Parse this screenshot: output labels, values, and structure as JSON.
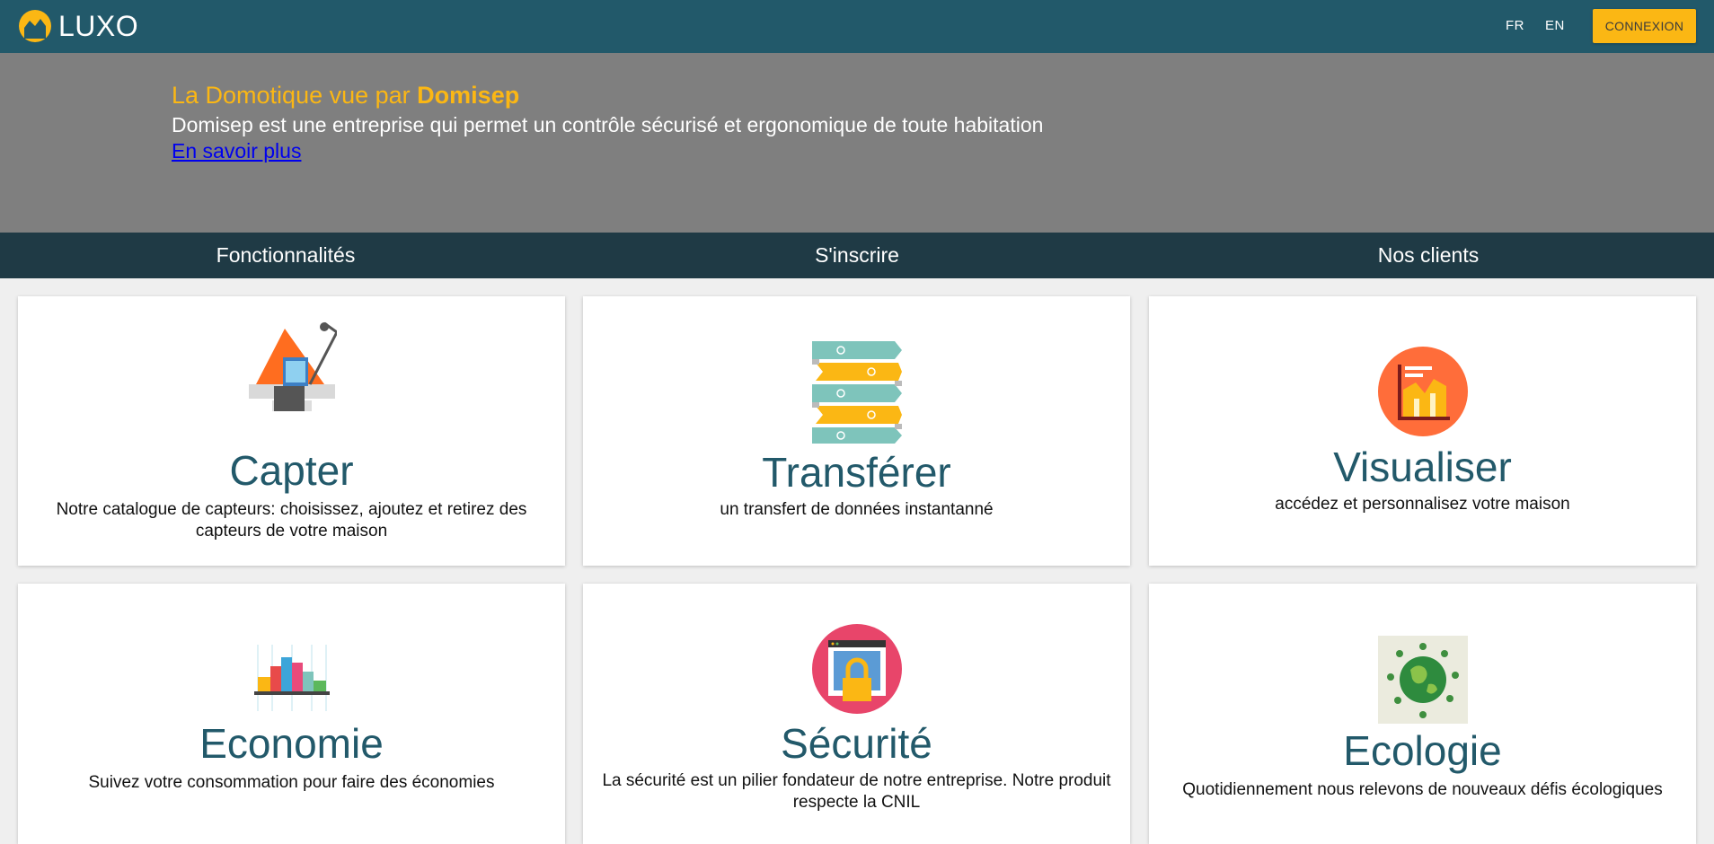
{
  "header": {
    "brand": "LUXO",
    "lang_fr": "FR",
    "lang_en": "EN",
    "login_label": "CONNEXION"
  },
  "hero": {
    "title_prefix": "La Domotique vue par ",
    "title_brand": "Domisep",
    "subtitle": "Domisep est une entreprise qui permet un contrôle sécurisé et ergonomique de toute habitation",
    "link": "En savoir plus"
  },
  "tabs": [
    "Fonctionnalités",
    "S'inscrire",
    "Nos clients"
  ],
  "features": [
    {
      "title": "Capter",
      "desc": "Notre catalogue de capteurs: choisissez, ajoutez et retirez des capteurs de votre maison",
      "icon": "desk-lamp-icon"
    },
    {
      "title": "Transférer",
      "desc": "un transfert de données instantanné",
      "icon": "transfer-arrows-icon"
    },
    {
      "title": "Visualiser",
      "desc": "accédez et personnalisez votre maison",
      "icon": "chart-icon"
    },
    {
      "title": "Economie",
      "desc": "Suivez votre consommation pour faire des économies",
      "icon": "city-icon"
    },
    {
      "title": "Sécurité",
      "desc": "La sécurité est un pilier fondateur de notre entreprise. Notre produit respecte la CNIL",
      "icon": "lock-icon"
    },
    {
      "title": "Ecologie",
      "desc": "Quotidiennement nous relevons de nouveaux défis écologiques",
      "icon": "globe-eco-icon"
    }
  ],
  "colors": {
    "topbar": "#22596a",
    "accent": "#fbb714",
    "hero_bg": "#7f7f7f",
    "tabs_bg": "#1f3a45",
    "title_text": "#22596a"
  }
}
